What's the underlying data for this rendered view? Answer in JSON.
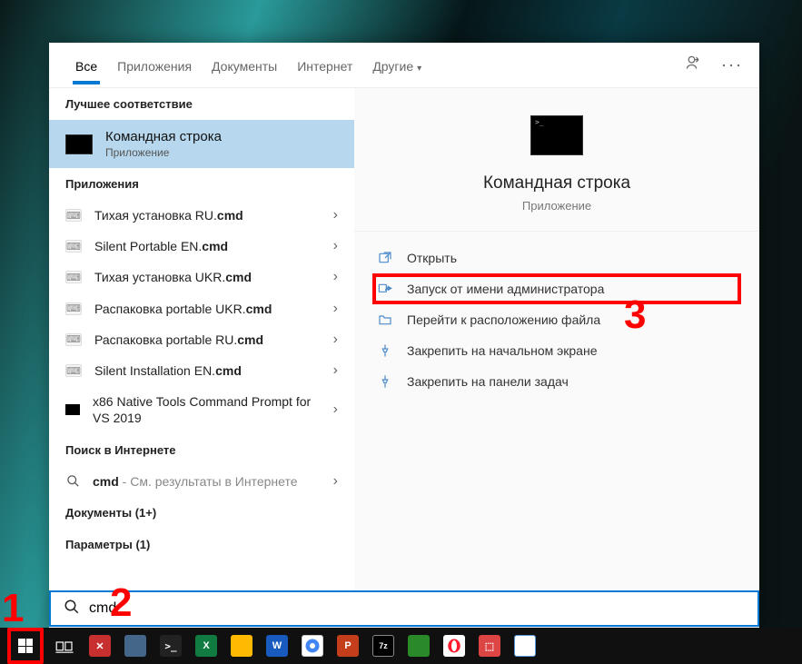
{
  "tabs": {
    "all": "Все",
    "apps": "Приложения",
    "docs": "Документы",
    "web": "Интернет",
    "more": "Другие"
  },
  "sections": {
    "best": "Лучшее соответствие",
    "apps": "Приложения",
    "web_search": "Поиск в Интернете",
    "docs": "Документы (1+)",
    "settings": "Параметры (1)"
  },
  "best_match": {
    "title": "Командная строка",
    "subtitle": "Приложение"
  },
  "app_items": [
    {
      "pre": "Тихая установка RU.",
      "bold": "cmd"
    },
    {
      "pre": "Silent Portable EN.",
      "bold": "cmd"
    },
    {
      "pre": "Тихая установка UKR.",
      "bold": "cmd"
    },
    {
      "pre": "Распаковка portable UKR.",
      "bold": "cmd"
    },
    {
      "pre": "Распаковка portable RU.",
      "bold": "cmd"
    },
    {
      "pre": "Silent Installation EN.",
      "bold": "cmd"
    },
    {
      "pre": "x86 Native Tools Command Prompt for VS 2019",
      "bold": "",
      "black": true
    }
  ],
  "web_item": {
    "bold": "cmd",
    "hint": " - См. результаты в Интернете"
  },
  "preview": {
    "title": "Командная строка",
    "subtitle": "Приложение"
  },
  "actions": {
    "open": "Открыть",
    "admin": "Запуск от имени администратора",
    "location": "Перейти к расположению файла",
    "pin_start": "Закрепить на начальном экране",
    "pin_task": "Закрепить на панели задач"
  },
  "search": {
    "value": "cmd"
  },
  "annotations": {
    "a1": "1",
    "a2": "2",
    "a3": "3"
  }
}
